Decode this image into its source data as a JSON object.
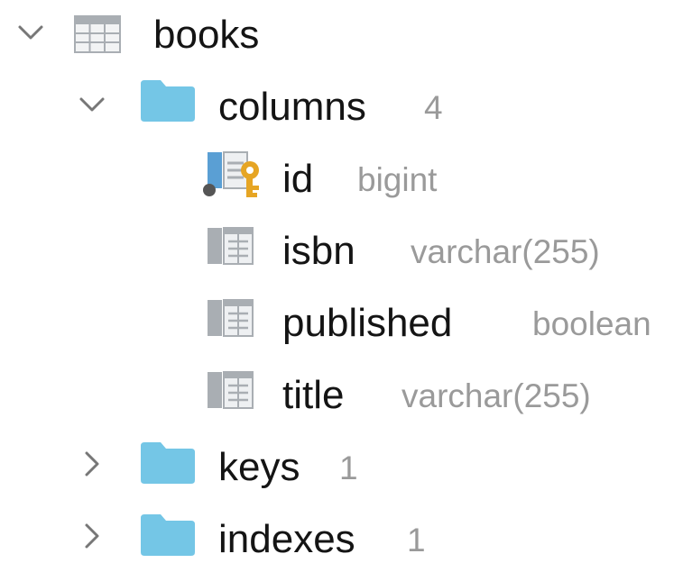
{
  "tree": {
    "table": {
      "name": "books",
      "expanded": true,
      "icon": "table-icon"
    },
    "columns_group": {
      "label": "columns",
      "count": "4",
      "expanded": true,
      "icon": "folder-icon",
      "items": [
        {
          "name": "id",
          "type": "bigint",
          "icon": "primary-key-column-icon"
        },
        {
          "name": "isbn",
          "type": "varchar(255)",
          "icon": "column-icon"
        },
        {
          "name": "published",
          "type": "boolean",
          "icon": "column-icon"
        },
        {
          "name": "title",
          "type": "varchar(255)",
          "icon": "column-icon"
        }
      ]
    },
    "keys_group": {
      "label": "keys",
      "count": "1",
      "expanded": false,
      "icon": "folder-icon"
    },
    "indexes_group": {
      "label": "indexes",
      "count": "1",
      "expanded": false,
      "icon": "folder-icon"
    }
  },
  "colors": {
    "folder": "#74c6e6",
    "key": "#e6a524",
    "column_icon": "#a9aeb3",
    "text": "#141414",
    "muted_text": "#9a9a9a",
    "chevron": "#777777"
  }
}
